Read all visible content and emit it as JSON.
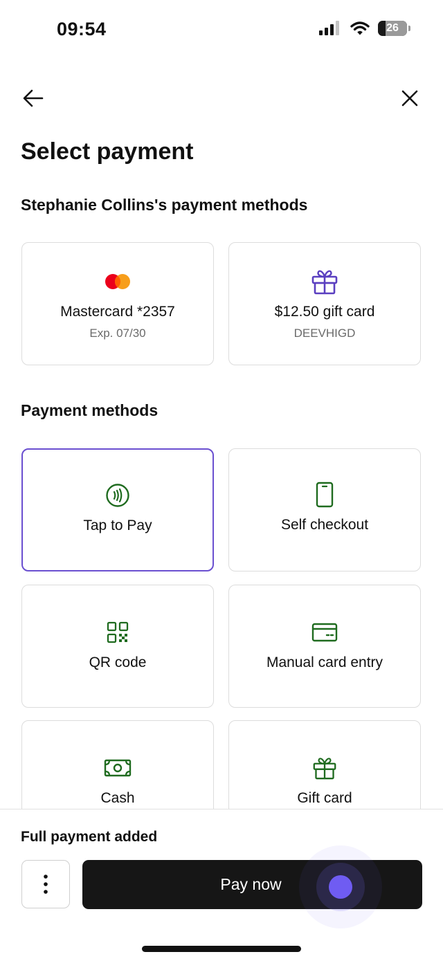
{
  "status_bar": {
    "time": "09:54",
    "battery": "26",
    "battery_level": 0.26
  },
  "header": {
    "title": "Select payment"
  },
  "saved_methods": {
    "title": "Stephanie Collins's payment methods",
    "cards": [
      {
        "title": "Mastercard *2357",
        "subtitle": "Exp. 07/30",
        "icon": "mastercard-icon"
      },
      {
        "title": "$12.50 gift card",
        "subtitle": "DEEVHIGD",
        "icon": "gift-icon"
      }
    ]
  },
  "payment_methods": {
    "title": "Payment methods",
    "options": [
      {
        "label": "Tap to Pay",
        "icon": "contactless-icon",
        "selected": true
      },
      {
        "label": "Self checkout",
        "icon": "phone-icon",
        "selected": false
      },
      {
        "label": "QR code",
        "icon": "qr-code-icon",
        "selected": false
      },
      {
        "label": "Manual card entry",
        "icon": "credit-card-icon",
        "selected": false
      },
      {
        "label": "Cash",
        "icon": "cash-icon",
        "selected": false
      },
      {
        "label": "Gift card",
        "icon": "gift-icon",
        "selected": false
      }
    ]
  },
  "footer": {
    "status": "Full payment added",
    "pay_label": "Pay now"
  },
  "colors": {
    "accent": "#6a4fd0",
    "icon_green": "#1f6b1f",
    "gift_purple": "#5a3fc0",
    "button": "#161616"
  }
}
